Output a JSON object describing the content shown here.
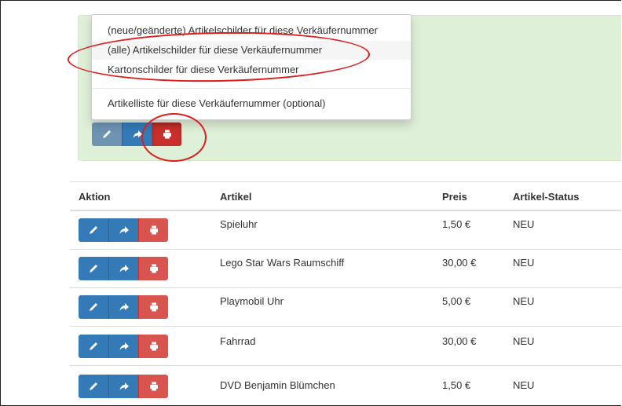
{
  "panel": {
    "actions": [
      "edit",
      "forward",
      "print"
    ]
  },
  "dropdown": {
    "items": [
      {
        "label": "(neue/geänderte) Artikelschilder für diese Verkäufernummer"
      },
      {
        "label": "(alle) Artikelschilder für diese Verkäufernummer"
      },
      {
        "label": "Kartonschilder für diese Verkäufernummer"
      },
      {
        "label": "Artikelliste für diese Verkäufernummer (optional)"
      }
    ],
    "highlighted_index": 1
  },
  "table": {
    "headers": {
      "action": "Aktion",
      "article": "Artikel",
      "price": "Preis",
      "status": "Artikel-Status"
    },
    "rows": [
      {
        "article": "Spieluhr",
        "price": "1,50 €",
        "status": "NEU"
      },
      {
        "article": "Lego Star Wars Raumschiff",
        "price": "30,00 €",
        "status": "NEU"
      },
      {
        "article": "Playmobil Uhr",
        "price": "5,00 €",
        "status": "NEU"
      },
      {
        "article": "Fahrrad",
        "price": "30,00 €",
        "status": "NEU"
      },
      {
        "article": "DVD Benjamin Blümchen",
        "price": "1,50 €",
        "status": "NEU"
      }
    ]
  },
  "colors": {
    "primary": "#337ab7",
    "danger": "#d9534f",
    "success_bg": "#dff0d8",
    "annotation": "#e01b1b"
  },
  "icons": {
    "edit": "pencil-icon",
    "forward": "share-arrow-icon",
    "print": "print-icon"
  }
}
